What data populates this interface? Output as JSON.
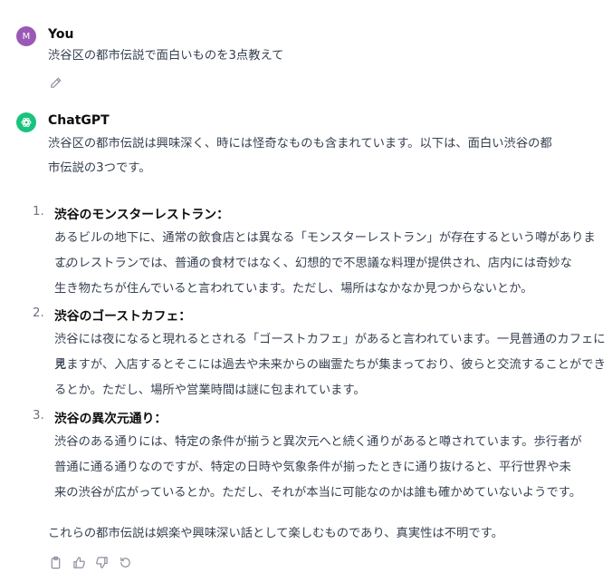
{
  "user_message": {
    "avatar_initial": "M",
    "author": "You",
    "text": "渋谷区の都市伝説で面白いものを3点教えて"
  },
  "assistant_message": {
    "author": "ChatGPT",
    "intro_line1": "渋谷区の都市伝説は興味深く、時には怪奇なものも含まれています。以下は、面白い渋谷の都",
    "intro_line2": "市伝説の3つです。",
    "items": [
      {
        "number": "1.",
        "title": "渋谷のモンスターレストラン：",
        "lines": [
          "あるビルの地下に、通常の飲食店とは異なる「モンスターレストラン」が存在するという噂があります。",
          "このレストランでは、普通の食材ではなく、幻想的で不思議な料理が提供され、店内には奇妙な",
          "生き物たちが住んでいると言われています。ただし、場所はなかなか見つからないとか。"
        ]
      },
      {
        "number": "2.",
        "title": "渋谷のゴーストカフェ：",
        "lines": [
          "渋谷には夜になると現れるとされる「ゴーストカフェ」があると言われています。一見普通のカフェに見",
          "えますが、入店するとそこには過去や未来からの幽霊たちが集まっており、彼らと交流することができ",
          "るとか。ただし、場所や営業時間は謎に包まれています。"
        ]
      },
      {
        "number": "3.",
        "title": "渋谷の異次元通り：",
        "lines": [
          "渋谷のある通りには、特定の条件が揃うと異次元へと続く通りがあると噂されています。歩行者が",
          "普通に通る通りなのですが、特定の日時や気象条件が揃ったときに通り抜けると、平行世界や未",
          "来の渋谷が広がっているとか。ただし、それが本当に可能なのかは誰も確かめていないようです。"
        ]
      }
    ],
    "outro": "これらの都市伝説は娯楽や興味深い話として楽しむものであり、真実性は不明です。"
  },
  "icons": {
    "edit": "pencil-icon",
    "copy": "clipboard-icon",
    "like": "thumbs-up-icon",
    "dislike": "thumbs-down-icon",
    "regenerate": "regenerate-icon"
  },
  "colors": {
    "user_avatar": "#9b59b6",
    "assistant_avatar": "#19c37d"
  }
}
